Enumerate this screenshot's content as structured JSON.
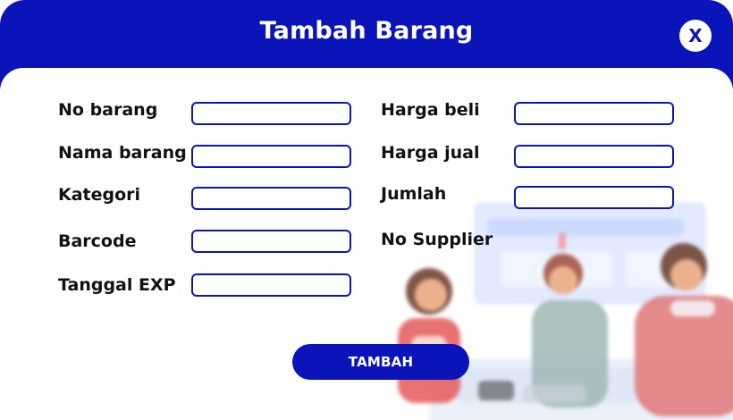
{
  "dialog": {
    "title": "Tambah Barang",
    "close_label": "X"
  },
  "form": {
    "labels": {
      "no_barang": "No barang",
      "nama_barang": "Nama barang",
      "kategori": "Kategori",
      "barcode": "Barcode",
      "tanggal_exp": "Tanggal EXP",
      "harga_beli": "Harga beli",
      "harga_jual": "Harga jual",
      "jumlah": "Jumlah",
      "no_supplier": "No Supplier"
    },
    "values": {
      "no_barang": "",
      "nama_barang": "",
      "kategori": "",
      "barcode": "",
      "tanggal_exp": "",
      "harga_beli": "",
      "harga_jual": "",
      "jumlah": ""
    },
    "submit_label": "TAMBAH"
  },
  "illustration": {
    "icon": "store-people-illustration"
  },
  "colors": {
    "primary": "#0a14b8",
    "background": "#ffffff",
    "text": "#111111"
  }
}
